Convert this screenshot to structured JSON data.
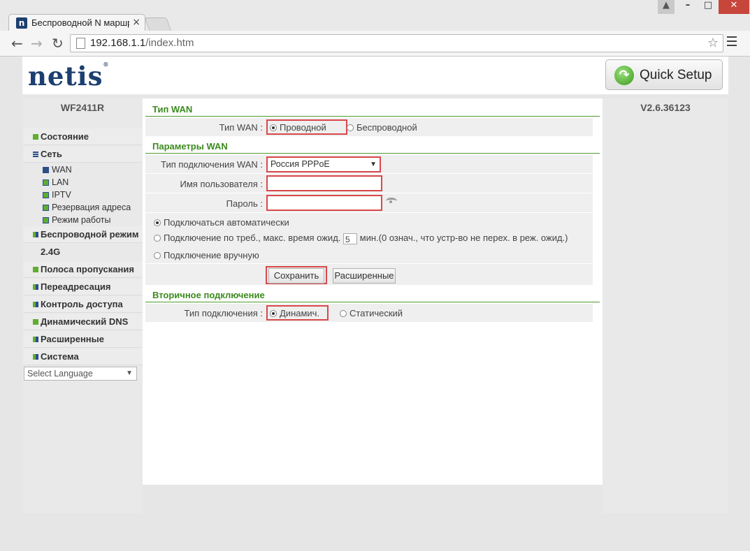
{
  "browser": {
    "tab_title": "Беспроводной N маршру",
    "favicon_letter": "n",
    "url_host": "192.168.1.1",
    "url_path": "/index.htm"
  },
  "header": {
    "logo": "netis",
    "logo_mark": "®",
    "quick_setup_label": "Quick Setup"
  },
  "sidebar": {
    "model": "WF2411R",
    "items": [
      {
        "label": "Состояние"
      },
      {
        "label": "Сеть"
      },
      {
        "label": "Беспроводной режим"
      },
      {
        "label": "Полоса пропускания"
      },
      {
        "label": "Переадресация"
      },
      {
        "label": "Контроль доступа"
      },
      {
        "label": "Динамический DNS"
      },
      {
        "label": "Расширенные"
      },
      {
        "label": "Система"
      }
    ],
    "subitems": [
      {
        "label": "WAN"
      },
      {
        "label": "LAN"
      },
      {
        "label": "IPTV"
      },
      {
        "label": "Резервация адреса"
      },
      {
        "label": "Режим работы"
      }
    ],
    "band": "2.4G",
    "language": "Select Language"
  },
  "version": "V2.6.36123",
  "form": {
    "wan_type": {
      "title": "Тип WAN",
      "label": "Тип WAN :",
      "option_wired": "Проводной",
      "option_wireless": "Беспроводной",
      "selected": "Проводной"
    },
    "wan_params": {
      "title": "Параметры WAN",
      "conn_type_label": "Тип подключения WAN :",
      "conn_type_value": "Россия PPPoE",
      "username_label": "Имя пользователя :",
      "username_value": "",
      "password_label": "Пароль :",
      "password_value": "",
      "opt_auto": "Подключаться автоматически",
      "opt_demand_before": "Подключение по треб., макс. время ожид.",
      "idle_value": "5",
      "opt_demand_after": "мин.(0 означ., что устр-во не перех. в реж. ожид.)",
      "opt_manual": "Подключение вручную",
      "selected": "Подключаться автоматически",
      "save_label": "Сохранить",
      "advanced_label": "Расширенные"
    },
    "secondary": {
      "title": "Вторичное подключение",
      "conn_label": "Тип подключения :",
      "opt_dynamic": "Динамич.",
      "opt_static": "Статический",
      "selected": "Динамич."
    }
  }
}
